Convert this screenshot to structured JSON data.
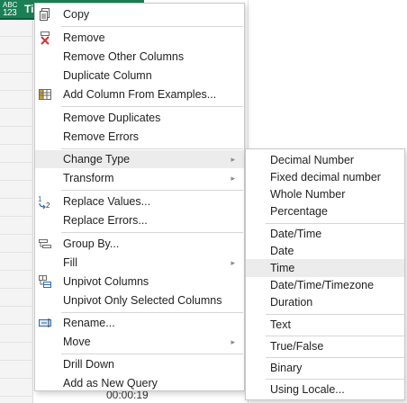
{
  "column_header": {
    "type_badge_top": "ABC",
    "type_badge_bottom": "123",
    "name": "Ti"
  },
  "background_value": "00:00:19",
  "context_menu": {
    "copy": "Copy",
    "remove": "Remove",
    "remove_other_columns": "Remove Other Columns",
    "duplicate_column": "Duplicate Column",
    "add_column_from_examples": "Add Column From Examples...",
    "remove_duplicates": "Remove Duplicates",
    "remove_errors": "Remove Errors",
    "change_type": "Change Type",
    "transform": "Transform",
    "replace_values": "Replace Values...",
    "replace_errors": "Replace Errors...",
    "group_by": "Group By...",
    "fill": "Fill",
    "unpivot_columns": "Unpivot Columns",
    "unpivot_only_selected_columns": "Unpivot Only Selected Columns",
    "rename": "Rename...",
    "move": "Move",
    "drill_down": "Drill Down",
    "add_as_new_query": "Add as New Query"
  },
  "change_type_submenu": {
    "decimal_number": "Decimal Number",
    "fixed_decimal_number": "Fixed decimal number",
    "whole_number": "Whole Number",
    "percentage": "Percentage",
    "date_time": "Date/Time",
    "date": "Date",
    "time": "Time",
    "date_time_timezone": "Date/Time/Timezone",
    "duration": "Duration",
    "text": "Text",
    "true_false": "True/False",
    "binary": "Binary",
    "using_locale": "Using Locale..."
  },
  "icons": {
    "copy": "copy-icon",
    "remove": "remove-column-icon",
    "add_column_from_examples": "column-from-examples-icon",
    "replace_values": "replace-values-icon",
    "group_by": "group-by-icon",
    "unpivot_columns": "unpivot-columns-icon",
    "rename": "rename-icon"
  },
  "colors": {
    "header_green": "#1a7f55",
    "hover_gray": "#ececec",
    "remove_x_red": "#d13438",
    "icon_blue": "#2b6cb0"
  }
}
